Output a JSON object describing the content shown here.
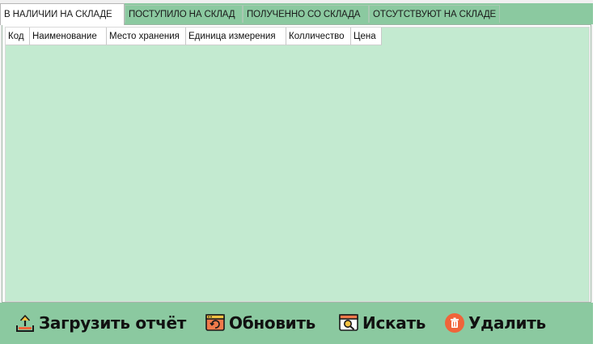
{
  "tabs": [
    {
      "label": "В НАЛИЧИИ НА СКЛАДЕ",
      "active": true
    },
    {
      "label": "ПОСТУПИЛО НА СКЛАД",
      "active": false
    },
    {
      "label": "ПОЛУЧЕННО СО СКЛАДА",
      "active": false
    },
    {
      "label": "ОТСУТСТВУЮТ НА СКЛАДЕ",
      "active": false
    }
  ],
  "table": {
    "columns": [
      "Код",
      "Наименование",
      "Место хранения",
      "Единица измерения",
      "Колличество",
      "Цена"
    ],
    "rows": []
  },
  "footer": {
    "upload": {
      "label": "Загрузить отчёт",
      "icon": "upload-icon"
    },
    "refresh": {
      "label": "Обновить",
      "icon": "refresh-window-icon"
    },
    "search": {
      "label": "Искать",
      "icon": "search-window-icon"
    },
    "delete": {
      "label": "Удалить",
      "icon": "trash-icon"
    }
  },
  "colors": {
    "accent_green": "#8bc9a0",
    "grid_background": "#c3ead0",
    "delete_orange": "#f0643a"
  }
}
